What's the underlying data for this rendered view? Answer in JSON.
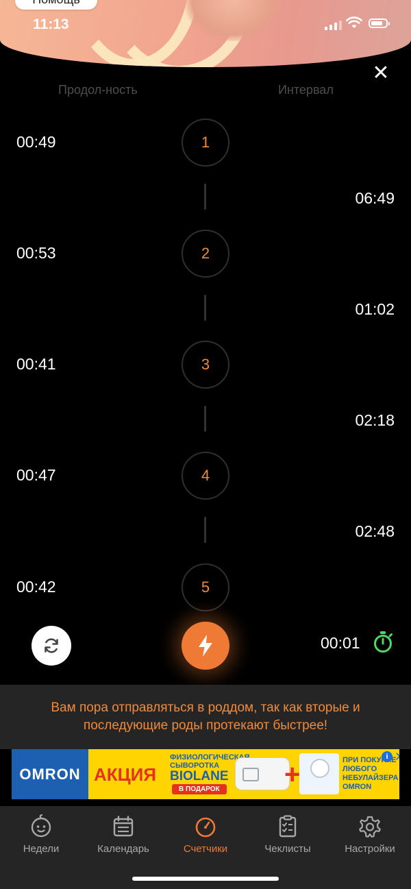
{
  "status_bar": {
    "time": "11:13"
  },
  "header": {
    "help_label": "Помощь"
  },
  "columns": {
    "duration": "Продол-ность",
    "interval": "Интервал"
  },
  "contractions": [
    {
      "number": "1",
      "duration": "00:49",
      "interval": "06:49"
    },
    {
      "number": "2",
      "duration": "00:53",
      "interval": "01:02"
    },
    {
      "number": "3",
      "duration": "00:41",
      "interval": "02:18"
    },
    {
      "number": "4",
      "duration": "00:47",
      "interval": "02:48"
    },
    {
      "number": "5",
      "duration": "00:42"
    }
  ],
  "controls": {
    "timer": "00:01"
  },
  "banner": {
    "text": "Вам пора отправляться в роддом, так как вторые и последующие роды протекают быстрее!"
  },
  "ad": {
    "logo": "OMRON",
    "promo": "АКЦИЯ",
    "serum_caption": "ФИЗИОЛОГИЧЕСКАЯ СЫВОРОТКА",
    "brand": "BIOLANE",
    "gift": "В ПОДАРОК",
    "right_text": "ПРИ ПОКУПКЕ ЛЮБОГО НЕБУЛАЙЗЕРА OMRON",
    "info": "i",
    "close": "✕"
  },
  "tabs": [
    {
      "label": "Недели",
      "icon": "baby-face-icon"
    },
    {
      "label": "Календарь",
      "icon": "calendar-icon"
    },
    {
      "label": "Счетчики",
      "icon": "counter-icon",
      "active": true
    },
    {
      "label": "Чеклисты",
      "icon": "checklist-icon"
    },
    {
      "label": "Настройки",
      "icon": "gear-icon"
    }
  ],
  "colors": {
    "accent": "#ef7a35",
    "banner_text": "#f08a3d",
    "timer_green": "#4cd964",
    "surface": "#252525"
  }
}
